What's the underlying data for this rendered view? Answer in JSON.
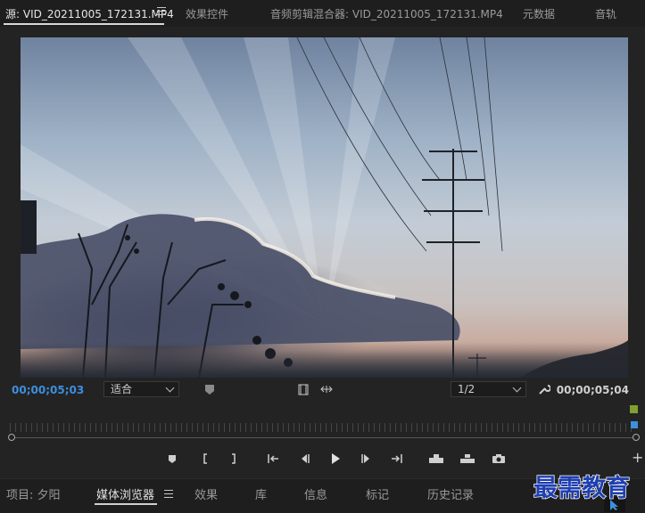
{
  "top_tabs": {
    "source": "源: VID_20211005_172131.MP4",
    "effect_controls": "效果控件",
    "audio_mixer": "音频剪辑混合器: VID_20211005_172131.MP4",
    "metadata": "元数据",
    "audio_track": "音轨"
  },
  "monitor": {
    "timecode_current": "00;00;05;03",
    "timecode_duration": "00;00;05;04",
    "zoom_select": "适合",
    "resolution_select": "1/2"
  },
  "bottom_tabs": {
    "project": "项目: 夕阳",
    "media_browser": "媒体浏览器",
    "effects": "效果",
    "library": "库",
    "info": "信息",
    "markers": "标记",
    "history": "历史记录"
  },
  "watermark": "最需教育",
  "colors": {
    "accent_blue": "#3d8fe0",
    "playhead_green": "#7fa030",
    "watermark_blue": "#1e3fb0"
  }
}
